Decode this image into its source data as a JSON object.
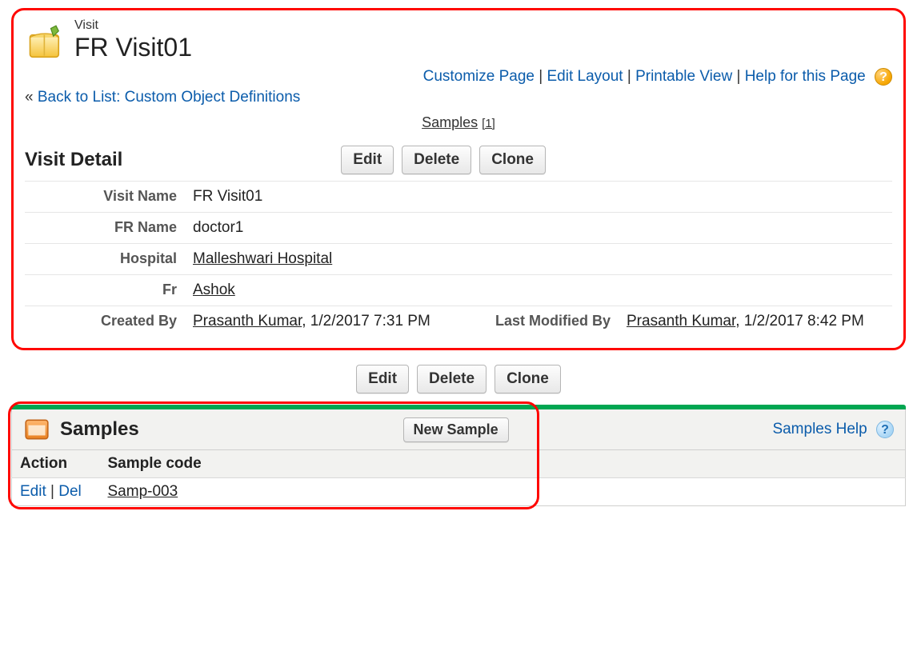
{
  "object": {
    "type_label": "Visit",
    "record_name": "FR Visit01"
  },
  "header_links": {
    "customize": "Customize Page",
    "edit_layout": "Edit Layout",
    "printable": "Printable View",
    "help": "Help for this Page"
  },
  "back_link": {
    "laquo": "«",
    "label": "Back to List: Custom Object Definitions"
  },
  "related_mini": {
    "label": "Samples",
    "count": "[1]"
  },
  "detail": {
    "section_title": "Visit Detail",
    "buttons": {
      "edit": "Edit",
      "delete": "Delete",
      "clone": "Clone"
    },
    "fields": {
      "visit_name_label": "Visit Name",
      "visit_name_value": "FR Visit01",
      "fr_name_label": "FR Name",
      "fr_name_value": "doctor1",
      "hospital_label": "Hospital",
      "hospital_value": "Malleshwari Hospital",
      "fr_label": "Fr",
      "fr_value": "Ashok",
      "created_by_label": "Created By",
      "created_by_user": "Prasanth Kumar",
      "created_by_date": ", 1/2/2017 7:31 PM",
      "last_modified_by_label": "Last Modified By",
      "last_modified_by_user": "Prasanth Kumar",
      "last_modified_by_date": ", 1/2/2017 8:42 PM"
    }
  },
  "samples": {
    "title": "Samples",
    "new_button": "New Sample",
    "help_label": "Samples Help",
    "columns": {
      "action": "Action",
      "code": "Sample code"
    },
    "rows": [
      {
        "edit": "Edit",
        "del": "Del",
        "code": "Samp-003"
      }
    ]
  }
}
